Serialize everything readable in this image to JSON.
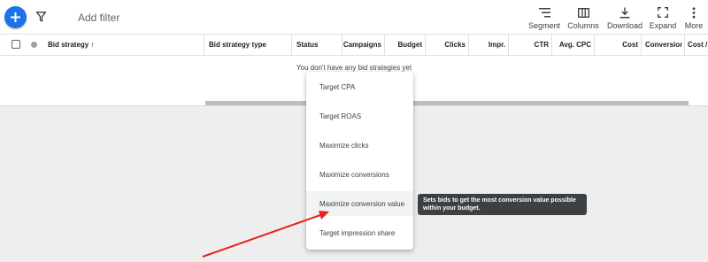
{
  "toolbar": {
    "add_filter": "Add filter",
    "segment": "Segment",
    "columns": "Columns",
    "download": "Download",
    "expand": "Expand",
    "more": "More"
  },
  "columns": [
    {
      "label": "Bid strategy ↑",
      "name": "col-bid-strategy"
    },
    {
      "label": "Bid strategy type",
      "name": "col-bid-strategy-type"
    },
    {
      "label": "Status",
      "name": "col-status"
    },
    {
      "label": "Campaigns",
      "name": "col-campaigns"
    },
    {
      "label": "Budget",
      "name": "col-budget"
    },
    {
      "label": "Clicks",
      "name": "col-clicks"
    },
    {
      "label": "Impr.",
      "name": "col-impr"
    },
    {
      "label": "CTR",
      "name": "col-ctr"
    },
    {
      "label": "Avg. CPC",
      "name": "col-avg-cpc"
    },
    {
      "label": "Cost",
      "name": "col-cost"
    },
    {
      "label": "Conversions",
      "name": "col-conversions"
    },
    {
      "label": "Cost / c",
      "name": "col-cost-per-conv"
    }
  ],
  "empty_message": "You don't have any bid strategies yet",
  "menu": {
    "items": [
      "Target CPA",
      "Target ROAS",
      "Maximize clicks",
      "Maximize conversions",
      "Maximize conversion value",
      "Target impression share"
    ],
    "hovered_index": 4
  },
  "tooltip": {
    "line1": "Sets bids to get the most conversion value possible",
    "line2": "within your budget."
  },
  "colors": {
    "accent": "#1a73e8",
    "annotation_arrow": "#e8231f",
    "tooltip_bg": "#3c4043"
  }
}
